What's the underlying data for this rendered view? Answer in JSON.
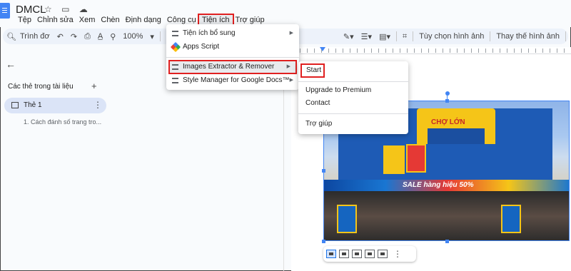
{
  "app": {
    "title": "DMCL",
    "title_icons": "☆ ▭ ☁"
  },
  "menubar": {
    "items": [
      "Tệp",
      "Chỉnh sửa",
      "Xem",
      "Chèn",
      "Định dạng",
      "Công cụ",
      "Tiện ích",
      "Trợ giúp"
    ],
    "active_index": 6
  },
  "toolbar": {
    "search_label": "Trình đơ",
    "zoom": "100%",
    "image_options": "Tùy chọn hình ảnh",
    "replace_image": "Thay thế hình ảnh"
  },
  "sidebar": {
    "heading": "Các thẻ trong tài liệu",
    "add_symbol": "+",
    "active_tab": "Thẻ 1",
    "outline_item": "1. Cách đánh số trang tro..."
  },
  "extensions_menu": {
    "items": [
      {
        "label": "Tiện ích bổ sung",
        "icon": "addons-icon",
        "has_submenu": true
      },
      {
        "label": "Apps Script",
        "icon": "apps-script-icon",
        "has_submenu": false
      },
      {
        "label": "Images Extractor & Remover",
        "icon": "addons-icon",
        "has_submenu": true,
        "highlighted": true
      },
      {
        "label": "Style Manager for Google Docs™",
        "icon": "addons-icon",
        "has_submenu": true
      }
    ]
  },
  "submenu": {
    "items": [
      "Start",
      "Upgrade to Premium",
      "Contact",
      "Trợ giúp"
    ]
  },
  "photo": {
    "store_sign": "CHỢ LỚN",
    "banner": "SALE hàng hiệu 50%"
  },
  "colors": {
    "highlight_outline": "#e02020",
    "accent": "#4285f4",
    "toolbar_bg": "#edf2fa",
    "active_tab_bg": "#dbe4f7"
  }
}
